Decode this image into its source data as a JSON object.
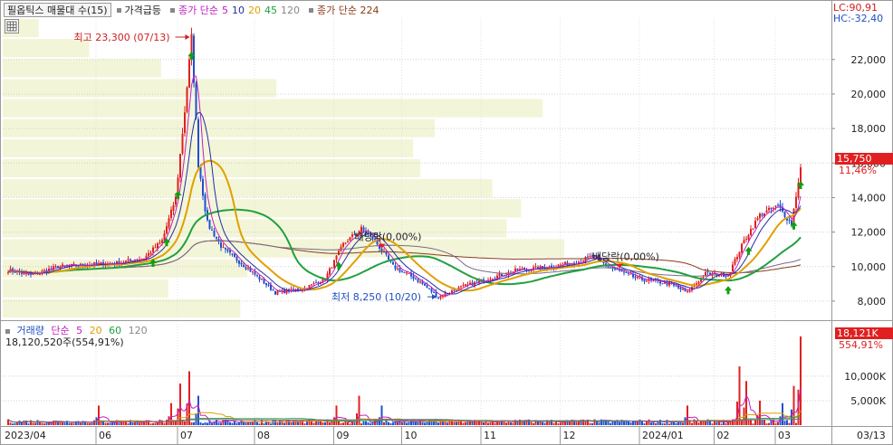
{
  "legend": {
    "stock": "필옵틱스 매물대 수(15)",
    "surge": "가격급등",
    "ma_label": "종가 단순",
    "ma_periods": [
      "5",
      "10",
      "20",
      "45",
      "120"
    ],
    "ma_colors": [
      "#c020c0",
      "#2030a0",
      "#e0a000",
      "#20a040",
      "#6a4a8a"
    ],
    "ma224_label": "종가 단순 224",
    "ma224_color": "#8b3a1a"
  },
  "lc_hc": {
    "lc": "LC:90,91",
    "hc": "HC:-32,40"
  },
  "price_marker": {
    "value": "15,750",
    "pct": "11,46%"
  },
  "volume_legend": {
    "title": "거래량",
    "ma_label": "단순",
    "periods": [
      "5",
      "20",
      "60",
      "120"
    ],
    "colors": [
      "#c020c0",
      "#e0a000",
      "#20a040",
      "#6a4a8a"
    ],
    "current": "18,120,520주(554,91%)"
  },
  "volume_marker": {
    "value": "18,121K",
    "pct": "554,91%"
  },
  "annotations": {
    "high": "최고 23,300 (07/13)",
    "low": "최저 8,250 (10/20)",
    "div1": "배당락(0,00%)",
    "div2": "배당락(0,00%)"
  },
  "chart_data": {
    "type": "candlestick",
    "price_axis": {
      "ylim": [
        7000,
        24400
      ],
      "ticks": [
        8000,
        10000,
        12000,
        14000,
        16000,
        18000,
        20000,
        22000
      ],
      "tick_labels": [
        "8,000",
        "10,000",
        "12,000",
        "14,000",
        "16,000",
        "18,000",
        "20,000",
        "22,000"
      ]
    },
    "volume_axis": {
      "ylim": [
        0,
        18121000
      ],
      "ticks": [
        5000000,
        10000000
      ],
      "tick_labels": [
        "5,000K",
        "10,000K"
      ]
    },
    "x_labels": [
      "2023/04",
      "06",
      "07",
      "08",
      "09",
      "10",
      "11",
      "12",
      "2024/01",
      "02",
      "03",
      "03/13"
    ],
    "key_points": [
      [
        0,
        9800
      ],
      [
        10,
        9500
      ],
      [
        22,
        10000
      ],
      [
        35,
        10100
      ],
      [
        48,
        10200
      ],
      [
        60,
        10500
      ],
      [
        68,
        11500
      ],
      [
        74,
        14000
      ],
      [
        78,
        19000
      ],
      [
        81,
        23300
      ],
      [
        84,
        16000
      ],
      [
        88,
        12500
      ],
      [
        95,
        11000
      ],
      [
        105,
        10000
      ],
      [
        118,
        8500
      ],
      [
        130,
        8700
      ],
      [
        140,
        9300
      ],
      [
        148,
        11300
      ],
      [
        156,
        12200
      ],
      [
        162,
        11500
      ],
      [
        170,
        10000
      ],
      [
        180,
        9300
      ],
      [
        190,
        8250
      ],
      [
        200,
        8800
      ],
      [
        212,
        9300
      ],
      [
        225,
        9800
      ],
      [
        240,
        10000
      ],
      [
        252,
        10300
      ],
      [
        258,
        10600
      ],
      [
        265,
        10000
      ],
      [
        278,
        9300
      ],
      [
        292,
        9000
      ],
      [
        300,
        8500
      ],
      [
        308,
        9600
      ],
      [
        318,
        9500
      ],
      [
        325,
        11500
      ],
      [
        332,
        13000
      ],
      [
        340,
        13500
      ],
      [
        346,
        12500
      ],
      [
        350,
        15750
      ]
    ],
    "volume_spikes": [
      [
        40,
        4000000
      ],
      [
        72,
        4500000
      ],
      [
        76,
        8500000
      ],
      [
        80,
        11000000
      ],
      [
        84,
        6000000
      ],
      [
        145,
        4000000
      ],
      [
        155,
        6000000
      ],
      [
        165,
        4000000
      ],
      [
        300,
        4000000
      ],
      [
        323,
        12000000
      ],
      [
        326,
        9000000
      ],
      [
        332,
        5000000
      ],
      [
        342,
        4500000
      ],
      [
        347,
        8000000
      ],
      [
        350,
        18121000
      ]
    ],
    "volume_profile": [
      0.33,
      0.23,
      0.34,
      0.78,
      0.7,
      0.72,
      0.68,
      0.58,
      0.57,
      0.6,
      0.75,
      0.38,
      0.22,
      0.12,
      0.05
    ]
  }
}
